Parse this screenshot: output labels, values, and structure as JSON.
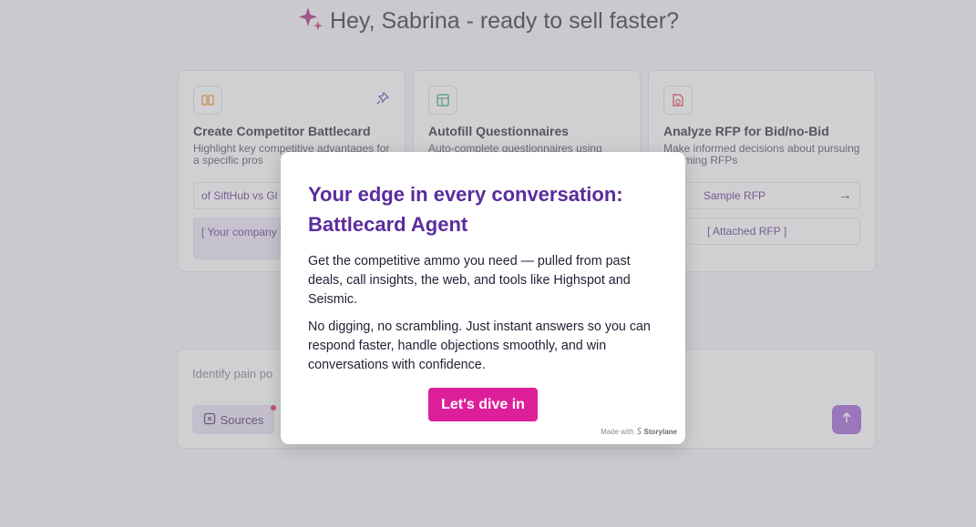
{
  "greeting": {
    "text": "Hey, Sabrina - ready to sell faster?"
  },
  "cards": [
    {
      "title": "Create Competitor Battlecard",
      "desc": "Highlight key competitive advantages for a specific pros",
      "chip1": "of SiftHub vs Gl",
      "chip2": "[ Your company ] for [ Prospect ]",
      "icon_color": "#e89a3b"
    },
    {
      "title": "Autofill Questionnaires",
      "desc": "Auto-complete questionnaires using",
      "icon_color": "#3fae6a"
    },
    {
      "title": "Analyze RFP for Bid/no-Bid",
      "desc": "Make informed decisions about pursuing incoming RFPs",
      "chip1": "Sample RFP",
      "chip2": "[ Attached RFP ]",
      "icon_color": "#e0465a"
    }
  ],
  "composer": {
    "placeholder": "Identify pain po",
    "sources_label": "Sources"
  },
  "modal": {
    "title": "Your edge in every conversation: Battlecard Agent",
    "para1": "Get the competitive ammo you need — pulled from past deals, call insights, the web, and tools like Highspot and Seismic.",
    "para2": "No digging, no scrambling. Just instant answers so you can respond faster, handle objections smoothly, and win conversations with confidence.",
    "cta": "Let's dive in",
    "made_with": "Made with",
    "brand": "Storylane"
  },
  "colors": {
    "accent": "#de1f9a",
    "title_purple": "#5b2c9c"
  }
}
